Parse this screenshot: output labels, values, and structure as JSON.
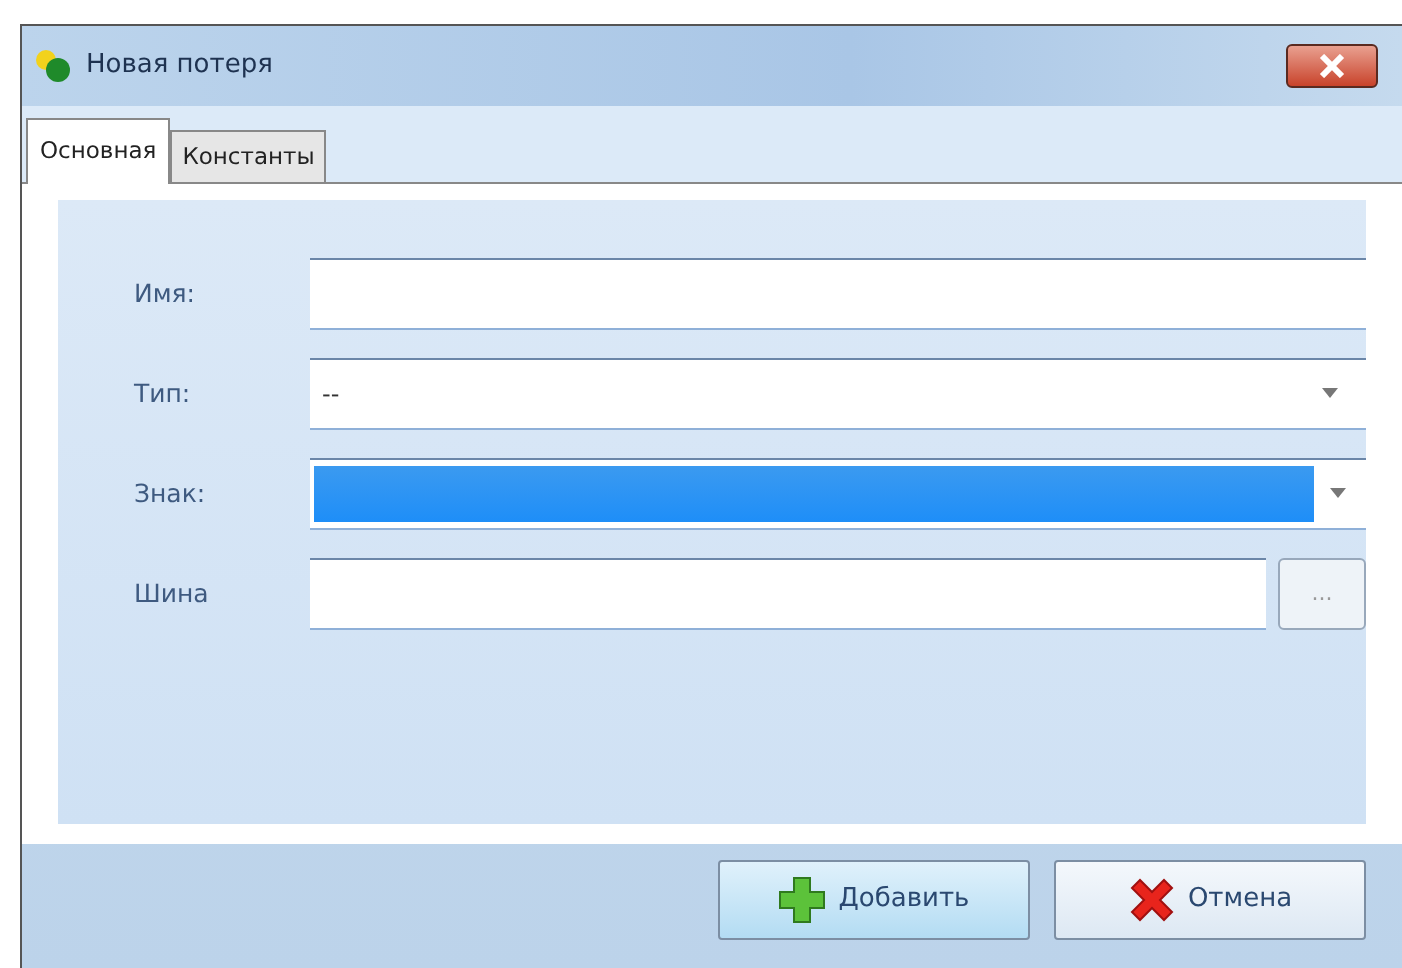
{
  "window": {
    "title": "Новая потеря"
  },
  "tabs": [
    {
      "label": "Основная",
      "selected": true
    },
    {
      "label": "Константы",
      "selected": false
    }
  ],
  "fields": [
    {
      "label": "Имя:",
      "kind": "text",
      "focused": false
    },
    {
      "label": "Тип:",
      "kind": "combo",
      "value": "--",
      "focused": false
    },
    {
      "label": "Знак:",
      "kind": "combo",
      "focused": true
    },
    {
      "label": "Шина",
      "kind": "browse",
      "button": "...",
      "focused": false
    }
  ],
  "buttons": [
    {
      "label": "Добавить",
      "kind": "add",
      "default": true
    },
    {
      "label": "Отмена",
      "kind": "cancel",
      "default": false
    }
  ]
}
